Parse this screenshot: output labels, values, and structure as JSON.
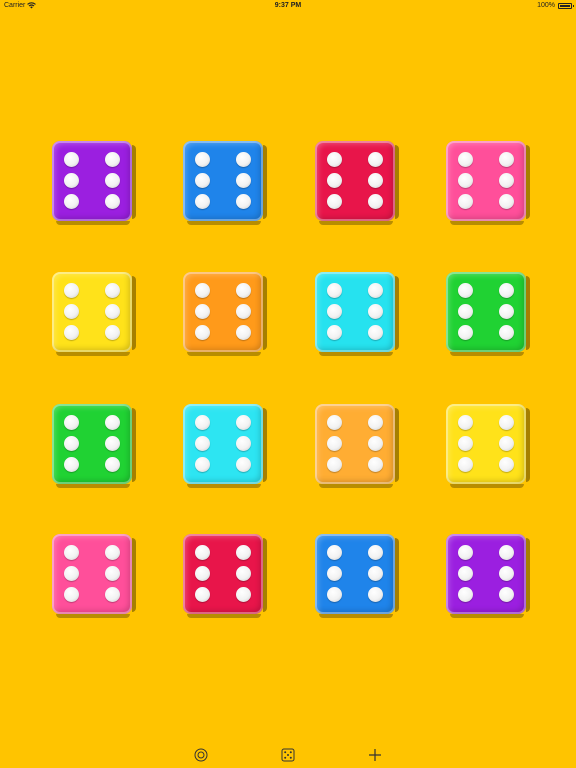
{
  "status_bar": {
    "carrier": "Carrier",
    "time": "9:37 PM",
    "battery": "100%"
  },
  "dice": [
    {
      "color": "#9b1fe0",
      "value": 6
    },
    {
      "color": "#1f84ea",
      "value": 6
    },
    {
      "color": "#e8154a",
      "value": 6
    },
    {
      "color": "#ff4f9a",
      "value": 6
    },
    {
      "color": "#ffe21a",
      "value": 6
    },
    {
      "color": "#ff9a1a",
      "value": 6
    },
    {
      "color": "#26e2ef",
      "value": 6
    },
    {
      "color": "#20d233",
      "value": 6
    },
    {
      "color": "#20d233",
      "value": 6
    },
    {
      "color": "#2de5f2",
      "value": 6
    },
    {
      "color": "#ffad33",
      "value": 6
    },
    {
      "color": "#ffe21a",
      "value": 6
    },
    {
      "color": "#ff4f9a",
      "value": 6
    },
    {
      "color": "#e8154a",
      "value": 6
    },
    {
      "color": "#1f84ea",
      "value": 6
    },
    {
      "color": "#9b1fe0",
      "value": 6
    }
  ],
  "toolbar": {
    "left_icon": "target-icon",
    "center_icon": "dice-icon",
    "right_icon": "plus-icon"
  }
}
